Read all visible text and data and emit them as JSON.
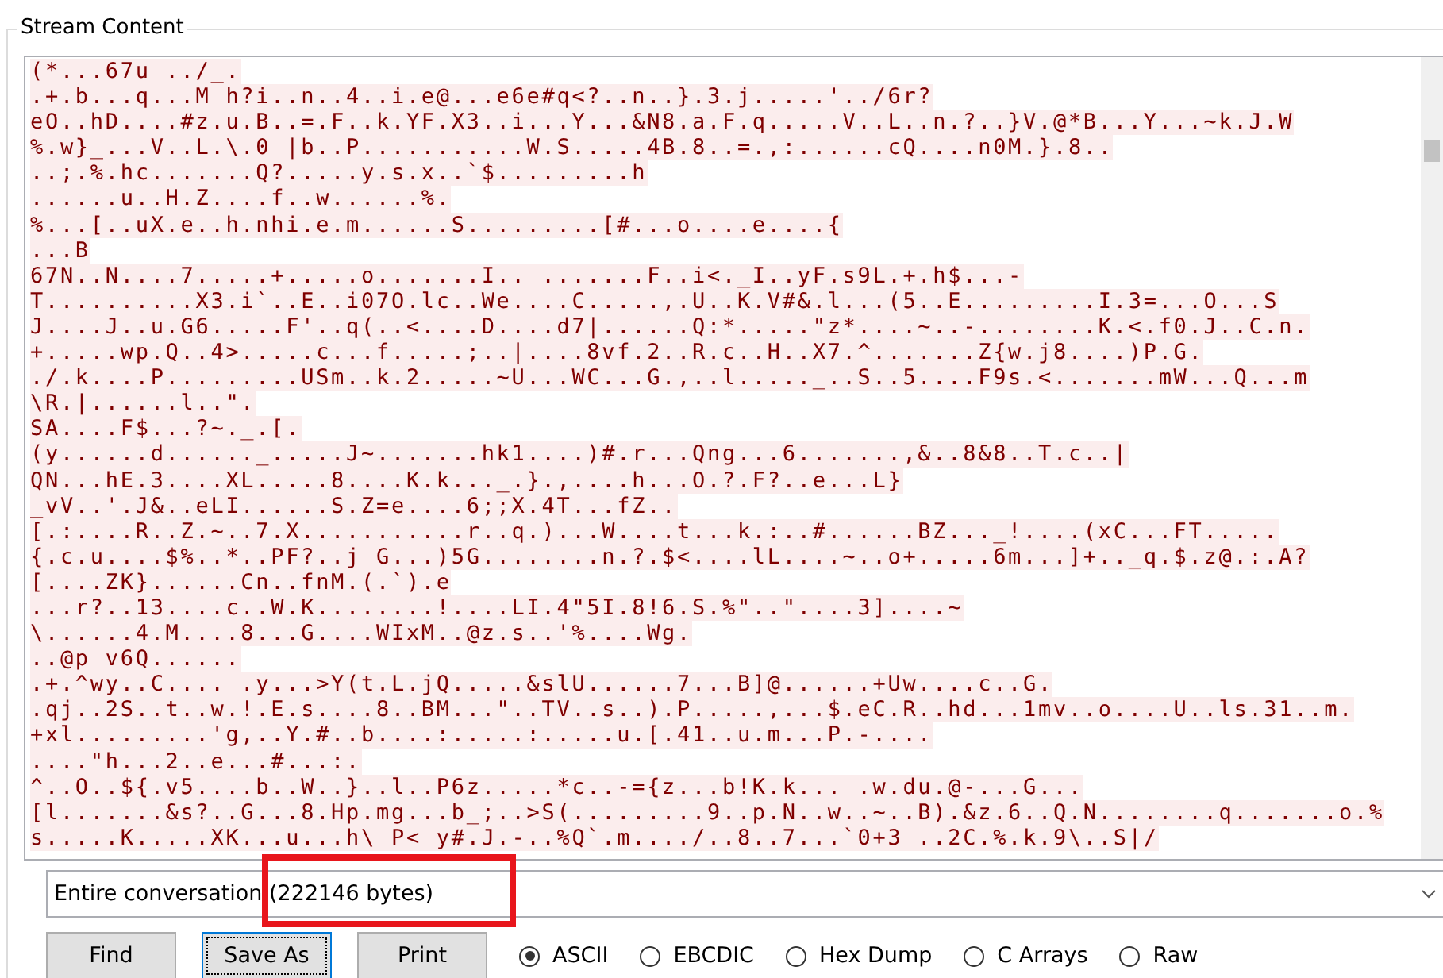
{
  "group_title": "Stream Content",
  "stream_lines": [
    "(*...67u ../_.",
    ".+.b...q...M h?i..n..4..i.e@...e6e#q<?..n..}.3.j.....'../6r?",
    "eO..hD....#z.u.B..=.F..k.YF.X3..i...Y...&N8.a.F.q.....V..L..n.?..}V.@*B...Y...~k.J.W",
    "%.w}_...V..L.\\.0 |b..P...........W.S.....4B.8..=.,:......cQ....n0M.}.8..",
    "..;.%.hc.......Q?.....y.s.x..`$.........h",
    "......u..H.Z....f..w......%.",
    "%...[..uX.e..h.nhi.e.m......S.........[#...o....e....{",
    "...B",
    "67N..N....7.....+.....o.......I.. .......F..i<._I..yF.s9L.+.h$...-",
    "T..........X3.i`..E..i07O.lc..We....C.....,.U..K.V#&.l...(5..E.........I.3=...O...S",
    "J....J..u.G6.....F'..q(..<....D....d7|......Q:*.....\"z*....~..-........K.<.f0.J..C.n.",
    "+.....wp.Q..4>.....c...f.....;..|....8vf.2..R.c..H..X7.^.......Z{w.j8....)P.G.",
    "./.k....P.........USm..k.2.....~U...WC...G.,..l....._..S..5....F9s.<.......mW...Q...m",
    "\\R.|......l..\".",
    "SA....F$...?~._.[.",
    "(y......d......_.....J~.......hk1....)#.r...Qng...6.......,&..8&8..T.c..|",
    "QN...hE.3....XL.....8....K.k..._.}.,....h...O.?.F?..e...L}",
    "_vV..'.J&..eLI......S.Z=e....6;;X.4T...fZ..",
    "[.:....R..Z.~..7.X...........r..q.)...W....t...k.:..#......BZ..._!....(xC...FT.....",
    "{.c.u....$%..*..PF?..j G...)5G........n.?.$<....lL....~..o+.....6m...]+.._q.$.z@.:.A?",
    "[....ZK}......Cn..fnM.(.`).e",
    "...r?..13....c..W.K........!....LI.4\"5I.8!6.S.%\"..\"....3]....~",
    "\\......4.M....8...G....WIxM..@z.s..'%....Wg.",
    "..@p v6Q......",
    ".+.^wy..C.... .y...>Y(t.L.jQ.....&slU......7...B]@......+Uw....c..G.",
    ".qj..2S..t..w.!.E.s....8..BM...\"..TV..s..).P.....,...$.eC.R..hd...1mv..o....U..ls.31..m.",
    "+xl.........'g,..Y.#..b....:.....:.....u.[.41..u.m...P.-....",
    "....\"h...2..e...#...:.",
    "^..O..${.v5....b..W..}..l..P6z.....*c..-={z...b!K.k... .w.du.@-...G...",
    "[l.......&s?..G...8.Hp.mg...b_;..>S(.........9..p.N..w..~..B).&z.6..Q.N........q.......o.%",
    "s.....K.....XK...u...h\\ P< y#.J.-..%Q`.m..../..8..7...`0+3 ..2C.%.k.9\\..S|/"
  ],
  "conversation_select": {
    "value": "Entire conversation (222146 bytes)"
  },
  "buttons": [
    {
      "label": "Find",
      "focused": false
    },
    {
      "label": "Save As",
      "focused": true
    },
    {
      "label": "Print",
      "focused": false
    }
  ],
  "radios": [
    {
      "label": "ASCII",
      "selected": true
    },
    {
      "label": "EBCDIC",
      "selected": false
    },
    {
      "label": "Hex Dump",
      "selected": false
    },
    {
      "label": "C Arrays",
      "selected": false
    },
    {
      "label": "Raw",
      "selected": false
    }
  ]
}
